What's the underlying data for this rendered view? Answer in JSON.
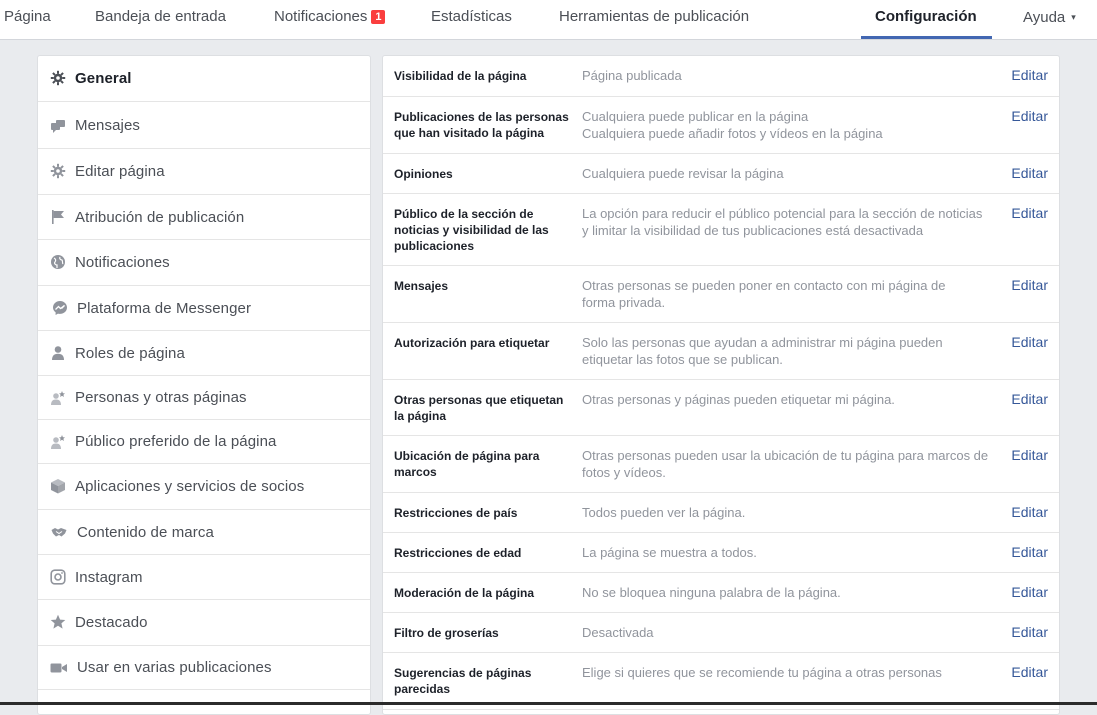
{
  "topnav": {
    "items": [
      {
        "label": "Página"
      },
      {
        "label": "Bandeja de entrada"
      },
      {
        "label": "Notificaciones",
        "badge": "1"
      },
      {
        "label": "Estadísticas"
      },
      {
        "label": "Herramientas de publicación"
      },
      {
        "label": "Configuración",
        "active": true
      },
      {
        "label": "Ayuda",
        "caret": "▾"
      }
    ]
  },
  "sidebar": {
    "items": [
      {
        "label": "General",
        "icon": "gear-icon",
        "active": true
      },
      {
        "label": "Mensajes",
        "icon": "messages-icon"
      },
      {
        "label": "Editar página",
        "icon": "gear-icon"
      },
      {
        "label": "Atribución de publicación",
        "icon": "flag-icon"
      },
      {
        "label": "Notificaciones",
        "icon": "globe-icon"
      },
      {
        "label": "Plataforma de Messenger",
        "icon": "messenger-icon"
      },
      {
        "label": "Roles de página",
        "icon": "person-icon"
      },
      {
        "label": "Personas y otras páginas",
        "icon": "person-star-icon"
      },
      {
        "label": "Público preferido de la página",
        "icon": "person-star-icon"
      },
      {
        "label": "Aplicaciones y servicios de socios",
        "icon": "cube-icon"
      },
      {
        "label": "Contenido de marca",
        "icon": "handshake-icon"
      },
      {
        "label": "Instagram",
        "icon": "instagram-icon"
      },
      {
        "label": "Destacado",
        "icon": "star-icon"
      },
      {
        "label": "Usar en varias publicaciones",
        "icon": "video-camera-icon"
      }
    ]
  },
  "settings": {
    "edit_label": "Editar",
    "rows": [
      {
        "label": "Visibilidad de la página",
        "value": [
          "Página publicada"
        ]
      },
      {
        "label": "Publicaciones de las personas que han visitado la página",
        "value": [
          "Cualquiera puede publicar en la página",
          "Cualquiera puede añadir fotos y vídeos en la página"
        ]
      },
      {
        "label": "Opiniones",
        "value": [
          "Cualquiera puede revisar la página"
        ]
      },
      {
        "label": "Público de la sección de noticias y visibilidad de las publicaciones",
        "value": [
          "La opción para reducir el público potencial para la sección de noticias y limitar la visibilidad de tus publicaciones está desactivada"
        ]
      },
      {
        "label": "Mensajes",
        "value": [
          "Otras personas se pueden poner en contacto con mi página de forma privada."
        ]
      },
      {
        "label": "Autorización para etiquetar",
        "value": [
          "Solo las personas que ayudan a administrar mi página pueden etiquetar las fotos que se publican."
        ]
      },
      {
        "label": "Otras personas que etiquetan la página",
        "value": [
          "Otras personas y páginas pueden etiquetar mi página."
        ]
      },
      {
        "label": "Ubicación de página para marcos",
        "value": [
          "Otras personas pueden usar la ubicación de tu página para marcos de fotos y vídeos."
        ]
      },
      {
        "label": "Restricciones de país",
        "value": [
          "Todos pueden ver la página."
        ]
      },
      {
        "label": "Restricciones de edad",
        "value": [
          "La página se muestra a todos."
        ]
      },
      {
        "label": "Moderación de la página",
        "value": [
          "No se bloquea ninguna palabra de la página."
        ]
      },
      {
        "label": "Filtro de groserías",
        "value": [
          "Desactivada"
        ]
      },
      {
        "label": "Sugerencias de páginas parecidas",
        "value": [
          "Elige si quieres que se recomiende tu página a otras personas"
        ]
      }
    ]
  },
  "colors": {
    "accent": "#4267b2",
    "link": "#365899",
    "badge": "#fa3e3e",
    "background": "#e9ebee"
  }
}
